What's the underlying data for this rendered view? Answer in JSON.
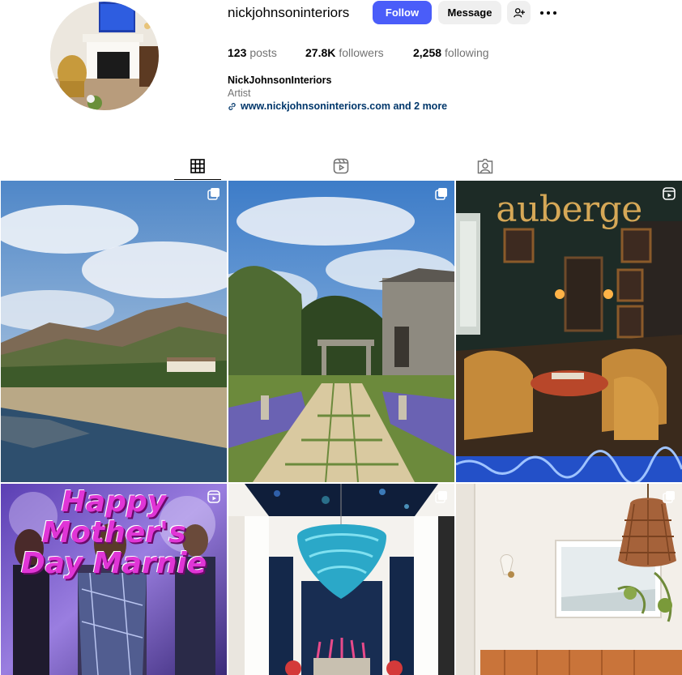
{
  "profile": {
    "username": "nickjohnsoninteriors",
    "follow_label": "Follow",
    "message_label": "Message",
    "add_user_icon": "user-plus-icon",
    "more_icon": "ellipsis-icon",
    "stats": {
      "posts_count": "123",
      "posts_label": "posts",
      "followers_count": "27.8K",
      "followers_label": "followers",
      "following_count": "2,258",
      "following_label": "following"
    },
    "full_name": "NickJohnsonInteriors",
    "category": "Artist",
    "link_text": "www.nickjohnsoninteriors.com and 2 more",
    "link_icon": "link-icon"
  },
  "tabs": [
    {
      "icon": "grid-icon",
      "active": true
    },
    {
      "icon": "reels-icon",
      "active": false
    },
    {
      "icon": "tagged-icon",
      "active": false
    }
  ],
  "posts": [
    {
      "scene": "coastal landscape with mountains and house",
      "badge": "carousel-icon"
    },
    {
      "scene": "stone path garden with stone house",
      "badge": "carousel-icon"
    },
    {
      "scene": "magazine cover dark green lounge",
      "title_text": "auberge",
      "badge": "reels-icon"
    },
    {
      "scene": "party photo with text overlay",
      "overlay_text": "Happy\nMother's\nDay Marnie",
      "badge": "reels-icon"
    },
    {
      "scene": "dining room with blue chandelier",
      "badge": "carousel-icon"
    },
    {
      "scene": "white room with woven pendant lamp",
      "badge": "carousel-icon"
    }
  ],
  "colors": {
    "follow_button": "#4a5df9",
    "secondary_button": "#efefef",
    "link": "#00376b",
    "muted_text": "#737373"
  }
}
